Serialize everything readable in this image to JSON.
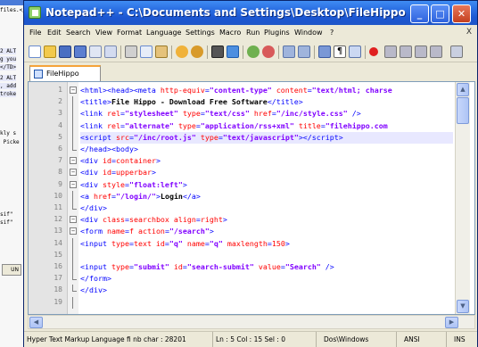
{
  "background_window": {
    "fragments": [
      {
        "text": "files.</FONT></TD>",
        "hl": false
      },
      {
        "text": "2 ALT",
        "hl": true
      },
      {
        "text": "g you",
        "hl": true
      },
      {
        "text": "</TD>",
        "hl": true
      },
      {
        "text": "2 ALT",
        "hl": true
      },
      {
        "text": ", add",
        "hl": true
      },
      {
        "text": "troke",
        "hl": true
      },
      {
        "text": "kly s",
        "hl": false
      },
      {
        "text": " Picke",
        "hl": false
      },
      {
        "text": "sif\"",
        "hl": false
      },
      {
        "text": "sif\"",
        "hl": false
      }
    ],
    "tab_label": "UN"
  },
  "window": {
    "title": "Notepad++ - C:\\Documents and Settings\\Desktop\\FileHippo",
    "controls": {
      "minimize": "_",
      "maximize": "□",
      "close": "✕"
    }
  },
  "menu": {
    "items": [
      "File",
      "Edit",
      "Search",
      "View",
      "Format",
      "Language",
      "Settings",
      "Macro",
      "Run",
      "Plugins",
      "Window",
      "?"
    ],
    "close_doc": "X"
  },
  "toolbar": {
    "icons": [
      "new-file",
      "open-file",
      "save",
      "save-all",
      "close",
      "close-all",
      "cut",
      "copy",
      "paste",
      "undo",
      "redo",
      "find",
      "replace",
      "zoom-in",
      "zoom-out",
      "sync-vertical",
      "sync-horizontal",
      "word-wrap",
      "show-all-chars",
      "indent-guide",
      "record-macro",
      "stop-record",
      "play-macro",
      "run-macro-multiple",
      "save-macro"
    ]
  },
  "tabs": [
    {
      "label": "FileHippo",
      "active": true
    }
  ],
  "editor": {
    "current_line": 5,
    "lines": [
      {
        "num": "1",
        "fold": "minus",
        "html": "<span class=\"t\">&lt;html&gt;&lt;head&gt;&lt;meta </span><span class=\"a\">http-equiv</span><span class=\"t\">=</span><span class=\"s\">\"content-type\"</span><span class=\"t\"> </span><span class=\"a\">content</span><span class=\"t\">=</span><span class=\"s\">\"text/html; charse</span>"
      },
      {
        "num": "2",
        "fold": "line",
        "html": "<span class=\"t\">&lt;title&gt;</span><span class=\"b\">File Hippo - Download Free Software</span><span class=\"t\">&lt;/title&gt;</span>"
      },
      {
        "num": "3",
        "fold": "line",
        "html": "<span class=\"t\">&lt;link </span><span class=\"a\">rel</span><span class=\"t\">=</span><span class=\"s\">\"stylesheet\"</span><span class=\"t\"> </span><span class=\"a\">type</span><span class=\"t\">=</span><span class=\"s\">\"text/css\"</span><span class=\"t\"> </span><span class=\"a\">href</span><span class=\"t\">=</span><span class=\"s\">\"/inc/style.css\"</span><span class=\"t\"> /&gt;</span>"
      },
      {
        "num": "4",
        "fold": "line",
        "html": "<span class=\"t\">&lt;link </span><span class=\"a\">rel</span><span class=\"t\">=</span><span class=\"s\">\"alternate\"</span><span class=\"t\"> </span><span class=\"a\">type</span><span class=\"t\">=</span><span class=\"s\">\"application/rss+xml\"</span><span class=\"t\"> </span><span class=\"a\">title</span><span class=\"t\">=</span><span class=\"s\">\"filehippo.com</span>"
      },
      {
        "num": "5",
        "fold": "line",
        "html": "<span class=\"t\">&lt;script </span><span class=\"a\">src</span><span class=\"t\">=</span><span class=\"s\">\"/inc/root.js\"</span><span class=\"t\"> </span><span class=\"a\">type</span><span class=\"t\">=</span><span class=\"s\">\"text/javascript\"</span><span class=\"t\">&gt;&lt;/script&gt;</span>"
      },
      {
        "num": "6",
        "fold": "end",
        "html": "<span class=\"t\">&lt;/head&gt;&lt;body&gt;</span>"
      },
      {
        "num": "7",
        "fold": "minus",
        "html": "<span class=\"t\">&lt;div </span><span class=\"a\">id</span><span class=\"t\">=</span><span class=\"a\">container</span><span class=\"t\">&gt;</span>"
      },
      {
        "num": "8",
        "fold": "minus",
        "html": "<span class=\"t\">&lt;div </span><span class=\"a\">id</span><span class=\"t\">=</span><span class=\"a\">upperbar</span><span class=\"t\">&gt;</span>"
      },
      {
        "num": "9",
        "fold": "minus",
        "html": "<span class=\"t\">&lt;div </span><span class=\"a\">style</span><span class=\"t\">=</span><span class=\"s\">\"float:left\"</span><span class=\"t\">&gt;</span>"
      },
      {
        "num": "10",
        "fold": "line",
        "html": "<span class=\"t\">&lt;a </span><span class=\"a\">href</span><span class=\"t\">=</span><span class=\"s\">\"/login/\"</span><span class=\"t\">&gt;</span><span class=\"b\">Login</span><span class=\"t\">&lt;/a&gt;</span>"
      },
      {
        "num": "11",
        "fold": "end",
        "html": "<span class=\"t\">&lt;/div&gt;</span>"
      },
      {
        "num": "12",
        "fold": "minus",
        "html": "<span class=\"t\">&lt;div </span><span class=\"a\">class</span><span class=\"t\">=</span><span class=\"a\">searchbox align</span><span class=\"t\">=</span><span class=\"a\">right</span><span class=\"t\">&gt;</span>"
      },
      {
        "num": "13",
        "fold": "minus",
        "html": "<span class=\"t\">&lt;form </span><span class=\"a\">name</span><span class=\"t\">=</span><span class=\"a\">f action</span><span class=\"t\">=</span><span class=\"s\">\"/search\"</span><span class=\"t\">&gt;</span>"
      },
      {
        "num": "14",
        "fold": "line",
        "html": "<span class=\"t\">&lt;input </span><span class=\"a\">type</span><span class=\"t\">=</span><span class=\"a\">text id</span><span class=\"t\">=</span><span class=\"s\">\"q\"</span><span class=\"t\"> </span><span class=\"a\">name</span><span class=\"t\">=</span><span class=\"s\">\"q\"</span><span class=\"t\"> </span><span class=\"a\">maxlength</span><span class=\"t\">=</span><span class=\"a\">150</span><span class=\"t\">&gt;</span>"
      },
      {
        "num": "15",
        "fold": "line",
        "html": ""
      },
      {
        "num": "16",
        "fold": "line",
        "html": "<span class=\"t\">&lt;input </span><span class=\"a\">type</span><span class=\"t\">=</span><span class=\"s\">\"submit\"</span><span class=\"t\"> </span><span class=\"a\">id</span><span class=\"t\">=</span><span class=\"s\">\"search-submit\"</span><span class=\"t\"> </span><span class=\"a\">value</span><span class=\"t\">=</span><span class=\"s\">\"Search\"</span><span class=\"t\"> /&gt;</span>"
      },
      {
        "num": "17",
        "fold": "end",
        "html": "<span class=\"t\">&lt;/form&gt;</span>"
      },
      {
        "num": "18",
        "fold": "end",
        "html": "<span class=\"t\">&lt;/div&gt;</span>"
      },
      {
        "num": "19",
        "fold": "line",
        "html": ""
      }
    ]
  },
  "status": {
    "language": "Hyper Text Markup Language fi nb char : 28201",
    "position": "Ln : 5   Col : 15   Sel : 0",
    "eol": "Dos\\Windows",
    "encoding": "ANSI",
    "mode": "INS"
  },
  "colors": {
    "tag": "#0000ff",
    "attribute": "#ff0000",
    "string": "#8000ff",
    "titlebar": "#2b6fe3",
    "current_line": "#e8e8ff"
  }
}
